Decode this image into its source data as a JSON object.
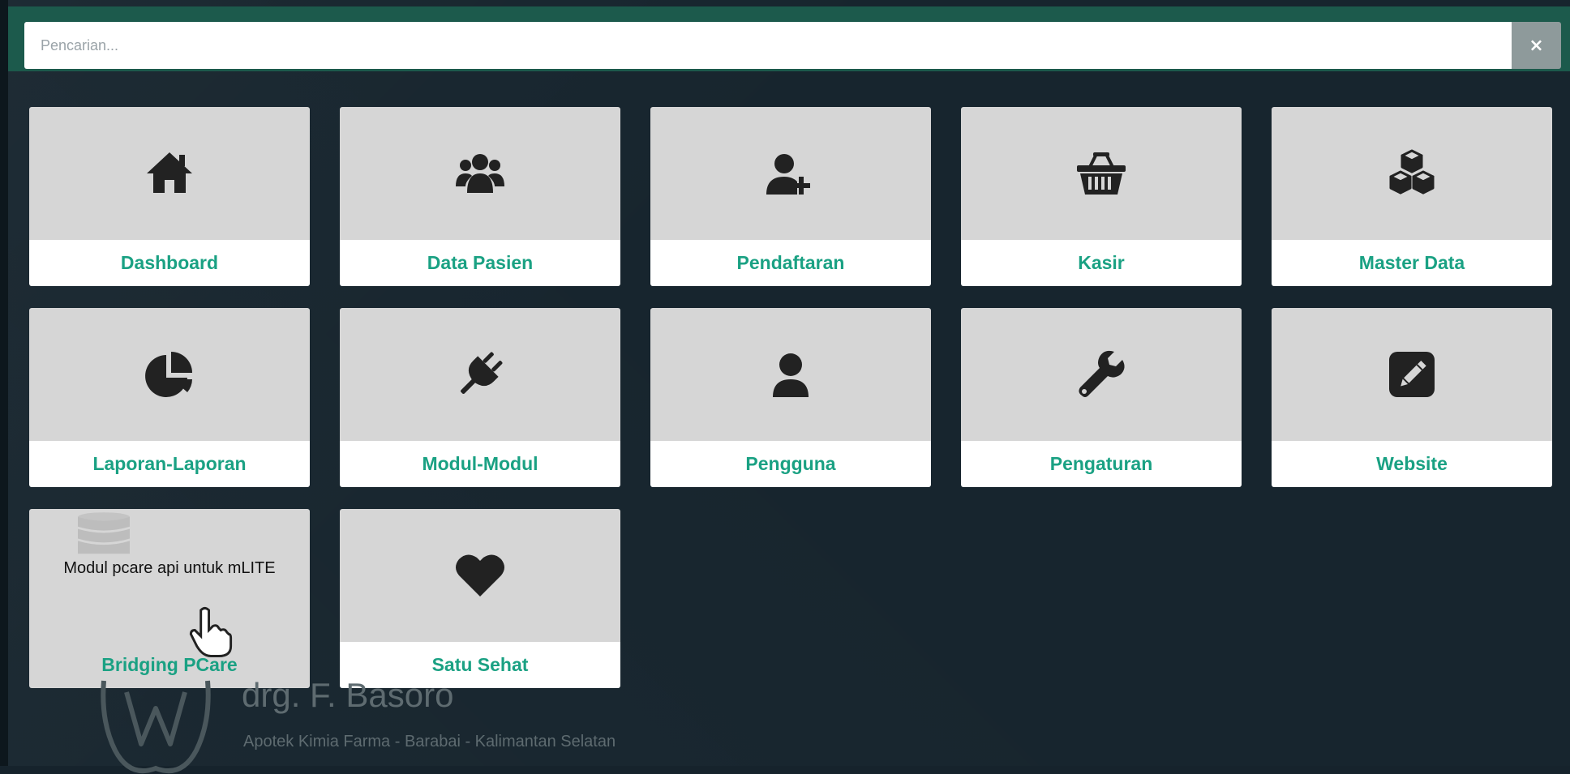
{
  "search": {
    "placeholder": "Pencarian...",
    "value": "",
    "close_label": "×"
  },
  "tiles": [
    {
      "label": "Dashboard",
      "icon": "home-icon"
    },
    {
      "label": "Data Pasien",
      "icon": "users-icon"
    },
    {
      "label": "Pendaftaran",
      "icon": "user-plus-icon"
    },
    {
      "label": "Kasir",
      "icon": "basket-icon"
    },
    {
      "label": "Master Data",
      "icon": "cubes-icon"
    },
    {
      "label": "Laporan-Laporan",
      "icon": "pie-chart-icon"
    },
    {
      "label": "Modul-Modul",
      "icon": "plug-icon"
    },
    {
      "label": "Pengguna",
      "icon": "user-icon"
    },
    {
      "label": "Pengaturan",
      "icon": "wrench-icon"
    },
    {
      "label": "Website",
      "icon": "edit-icon"
    },
    {
      "label": "Bridging PCare",
      "icon": "database-icon",
      "tooltip": "Modul pcare api untuk mLITE"
    },
    {
      "label": "Satu Sehat",
      "icon": "heart-icon"
    }
  ],
  "brand": {
    "name": "drg. F. Basoro",
    "subtitle": "Apotek Kimia Farma - Barabai - Kalimantan Selatan"
  },
  "colors": {
    "background": "#17252e",
    "topbar": "#1c5a4c",
    "tile_top": "#d6d6d6",
    "label_text": "#1aa183",
    "icon": "#222222"
  }
}
